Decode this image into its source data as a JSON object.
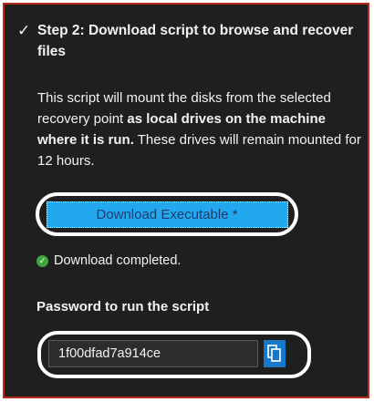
{
  "step": {
    "check_glyph": "✓",
    "title": "Step 2: Download script to browse and recover files"
  },
  "description": {
    "part1": "This script will mount the disks from the selected recovery point ",
    "bold": "as local drives on the machine where it is run.",
    "part2": " These drives will remain mounted for 12 hours."
  },
  "download": {
    "label": "Download Executable *"
  },
  "status": {
    "icon": "check-circle-icon",
    "text": "Download completed."
  },
  "password": {
    "label": "Password to run the script",
    "value": "1f00dfad7a914ce",
    "copy_icon": "copy-icon"
  },
  "colors": {
    "panel_bg": "#1f1f1f",
    "border": "#b3281f",
    "button_bg": "#22a8ee",
    "button_text": "#1d3c6e",
    "success": "#3fa63f",
    "copy_bg": "#1778c9"
  }
}
